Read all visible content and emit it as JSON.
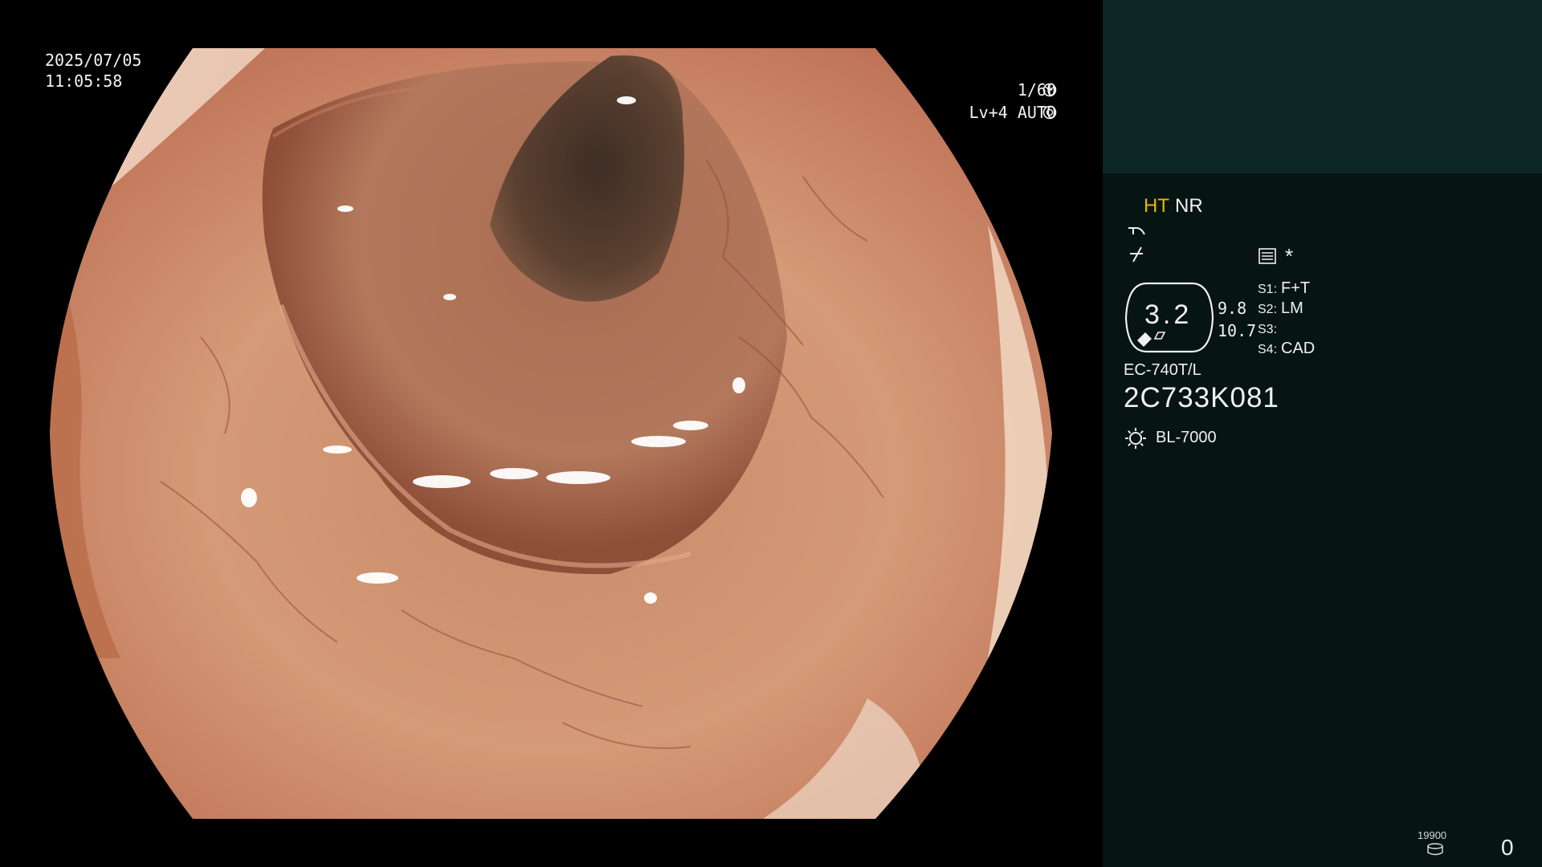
{
  "osd": {
    "date": "2025/07/05",
    "time": "11:05:58",
    "shutter": "1/60",
    "level": "Lv+4 AUTO"
  },
  "panel": {
    "mode_ht": "HT",
    "mode_nr": "NR",
    "zoom_value": "3.2",
    "sub_value_1": "9.8",
    "sub_value_2": "10.7",
    "s1_label": "S1:",
    "s1_value": "F+T",
    "s2_label": "S2:",
    "s2_value": "LM",
    "s3_label": "S3:",
    "s3_value": "",
    "s4_label": "S4:",
    "s4_value": "CAD",
    "asterisk": "*",
    "scope_model": "EC-740T/L",
    "serial": "2C733K081",
    "light_source": "BL-7000",
    "storage_count": "19900",
    "counter": "0"
  },
  "icons": [
    "shutter-icon",
    "auto-iris-icon",
    "curve-icon",
    "slash-icon",
    "menu-icon",
    "sun-icon",
    "storage-icon"
  ]
}
